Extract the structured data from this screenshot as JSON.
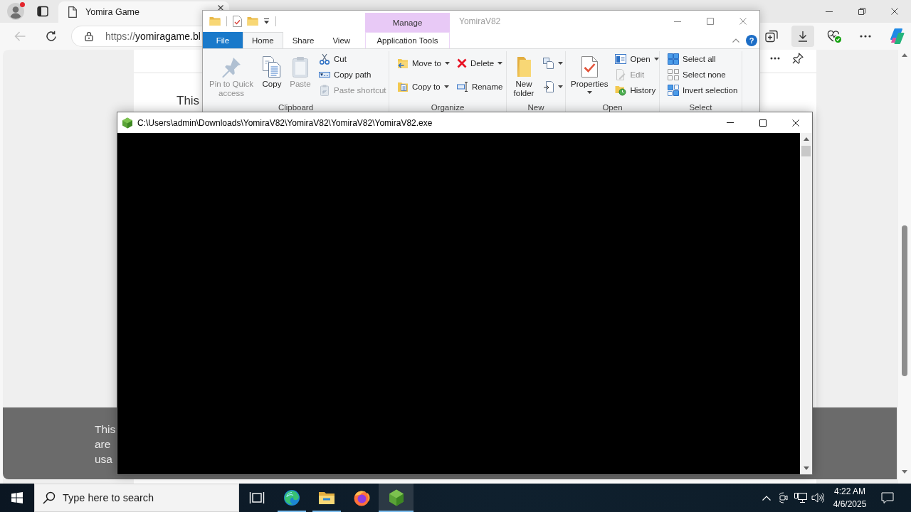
{
  "browser": {
    "tabs": [
      {
        "title": "Yomira Game",
        "selected": true
      }
    ],
    "back": {
      "disabled": true
    },
    "address": {
      "scheme": "https://",
      "host": "yomiragame.bl"
    },
    "toolbar": [
      {
        "kind": "collections",
        "selected": false
      },
      {
        "kind": "downloads",
        "selected": true
      },
      {
        "kind": "essentials",
        "selected": false
      },
      {
        "kind": "more",
        "selected": false
      },
      {
        "kind": "copilot",
        "selected": false
      }
    ],
    "page": {
      "text": "This"
    },
    "cookie_banner": {
      "lines": [
        "This",
        "are",
        "usa"
      ]
    }
  },
  "explorer": {
    "title": "YomiraV82",
    "context_label": "Manage",
    "help": "?",
    "tabs": [
      {
        "label": "File",
        "kind": "file",
        "selected": false
      },
      {
        "label": "Home",
        "kind": "tab",
        "selected": true
      },
      {
        "label": "Share",
        "kind": "tab",
        "selected": false
      },
      {
        "label": "View",
        "kind": "tab",
        "selected": false
      },
      {
        "label": "Application Tools",
        "kind": "context",
        "selected": false
      }
    ],
    "groups": [
      {
        "label": "Clipboard",
        "columns": [
          {
            "kind": "large",
            "items": [
              {
                "kind": "pin",
                "label": "Pin to Quick access",
                "disabled": true,
                "dropdown": false
              }
            ]
          },
          {
            "kind": "large",
            "items": [
              {
                "kind": "copy",
                "label": "Copy",
                "disabled": false,
                "dropdown": false
              }
            ]
          },
          {
            "kind": "large",
            "items": [
              {
                "kind": "paste",
                "label": "Paste",
                "disabled": true,
                "dropdown": false
              }
            ]
          },
          {
            "kind": "small",
            "items": [
              {
                "kind": "cut",
                "label": "Cut",
                "disabled": false,
                "dropdown": false
              },
              {
                "kind": "copy-path",
                "label": "Copy path",
                "disabled": false,
                "dropdown": false
              },
              {
                "kind": "paste-shortcut",
                "label": "Paste shortcut",
                "disabled": true,
                "dropdown": false
              }
            ]
          }
        ]
      },
      {
        "label": "Organize",
        "columns": [
          {
            "kind": "small",
            "items": [
              {
                "kind": "move-to",
                "label": "Move to",
                "disabled": false,
                "dropdown": true
              },
              {
                "kind": "copy-to",
                "label": "Copy to",
                "disabled": false,
                "dropdown": true
              }
            ]
          },
          {
            "kind": "small",
            "items": [
              {
                "kind": "delete",
                "label": "Delete",
                "disabled": false,
                "dropdown": true
              },
              {
                "kind": "rename",
                "label": "Rename",
                "disabled": false,
                "dropdown": false
              }
            ]
          }
        ]
      },
      {
        "label": "New",
        "columns": [
          {
            "kind": "large",
            "items": [
              {
                "kind": "new-folder",
                "label": "New folder",
                "disabled": false,
                "dropdown": false
              }
            ]
          },
          {
            "kind": "small",
            "items": [
              {
                "kind": "new-item",
                "disabled": false,
                "dropdown": true
              },
              {
                "kind": "easy-access",
                "disabled": false,
                "dropdown": true
              }
            ]
          }
        ]
      },
      {
        "label": "Open",
        "columns": [
          {
            "kind": "large",
            "items": [
              {
                "kind": "properties",
                "label": "Properties",
                "disabled": false,
                "dropdown": true
              }
            ]
          },
          {
            "kind": "small",
            "items": [
              {
                "kind": "open",
                "label": "Open",
                "disabled": false,
                "dropdown": true
              },
              {
                "kind": "edit",
                "label": "Edit",
                "disabled": true,
                "dropdown": false
              },
              {
                "kind": "history",
                "label": "History",
                "disabled": false,
                "dropdown": false
              }
            ]
          }
        ]
      },
      {
        "label": "Select",
        "columns": [
          {
            "kind": "small",
            "items": [
              {
                "kind": "select-all",
                "label": "Select all",
                "disabled": false,
                "dropdown": false
              },
              {
                "kind": "select-none",
                "label": "Select none",
                "disabled": false,
                "dropdown": false
              },
              {
                "kind": "invert-selection",
                "label": "Invert selection",
                "disabled": false,
                "dropdown": false
              }
            ]
          }
        ]
      }
    ]
  },
  "console": {
    "title": "C:\\Users\\admin\\Downloads\\YomiraV82\\YomiraV82\\YomiraV82\\YomiraV82.exe"
  },
  "taskbar": {
    "search": {
      "placeholder": "Type here to search"
    },
    "apps": [
      {
        "kind": "taskview",
        "running": false,
        "selected": false
      },
      {
        "kind": "edge",
        "running": true,
        "selected": false
      },
      {
        "kind": "explorer",
        "running": true,
        "selected": false
      },
      {
        "kind": "firefox",
        "running": false,
        "selected": false
      },
      {
        "kind": "cube",
        "running": true,
        "selected": true
      }
    ],
    "clock": {
      "time": "4:22 AM",
      "date": "4/6/2025"
    }
  }
}
